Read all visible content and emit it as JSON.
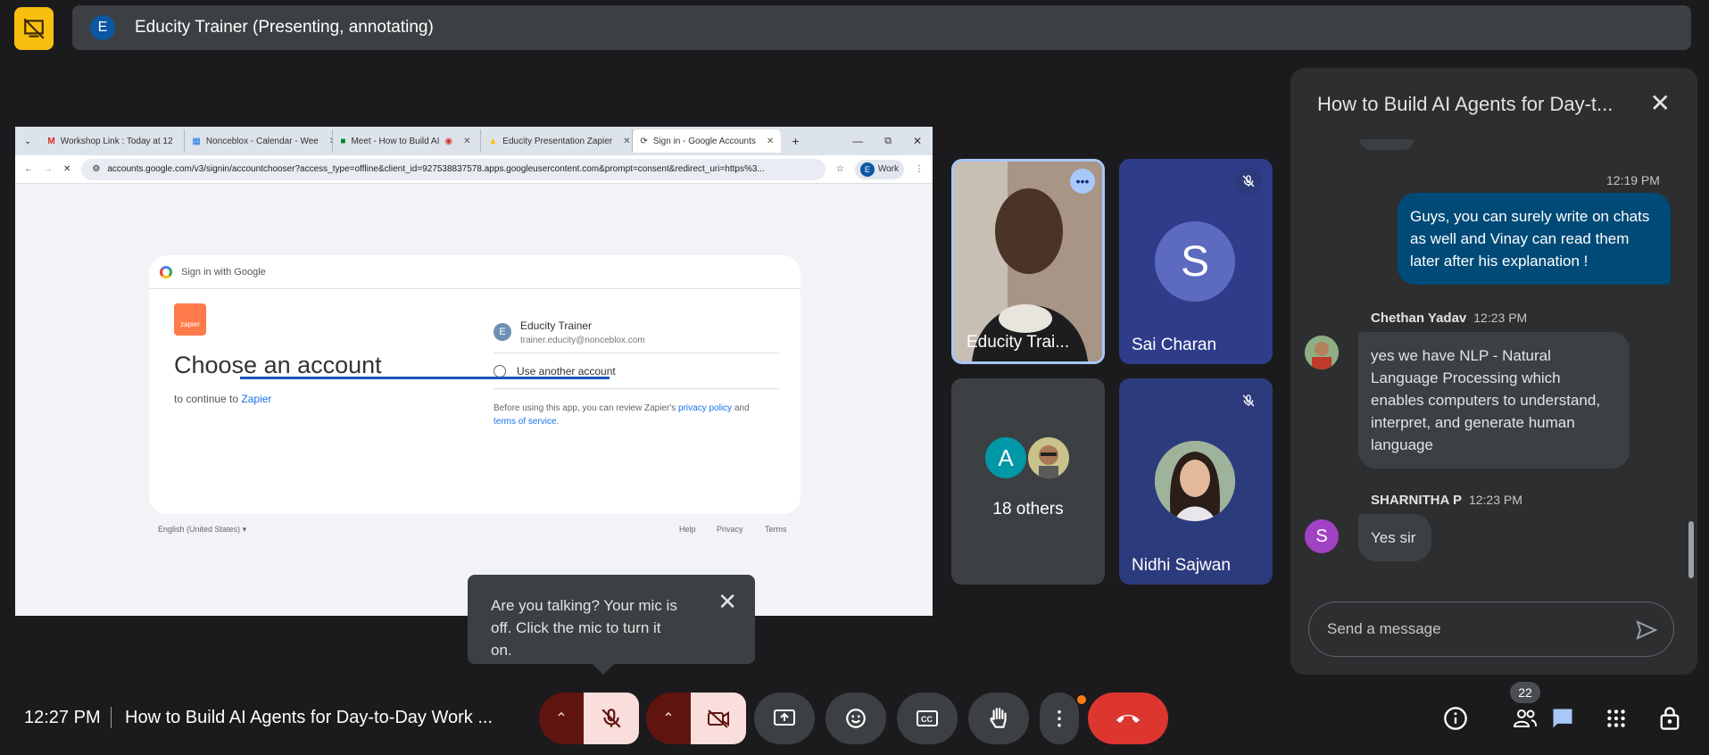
{
  "presenter": {
    "avatar_letter": "E",
    "label": "Educity Trainer (Presenting, annotating)"
  },
  "browser": {
    "tabs": [
      {
        "label": "Workshop Link : Today at 12",
        "icon": "gmail-icon"
      },
      {
        "label": "Nonceblox - Calendar - Wee",
        "icon": "calendar-icon"
      },
      {
        "label": "Meet - How to Build AI",
        "icon": "meet-icon"
      },
      {
        "label": "Educity Presentation Zapier",
        "icon": "drive-icon"
      },
      {
        "label": "Sign in - Google Accounts",
        "icon": "google-icon"
      }
    ],
    "url": "accounts.google.com/v3/signin/accountchooser?access_type=offline&client_id=927538837578.apps.googleusercontent.com&prompt=consent&redirect_uri=https%3...",
    "profile": {
      "letter": "E",
      "label": "Work"
    }
  },
  "signin": {
    "header": "Sign in with Google",
    "app_logo": "zapier",
    "heading": "Choose an account",
    "continue_prefix": "to continue to ",
    "continue_app": "Zapier",
    "account": {
      "letter": "E",
      "name": "Educity Trainer",
      "email": "trainer.educity@nonceblox.com"
    },
    "another": "Use another account",
    "fine_print_1": "Before using this app, you can review Zapier's ",
    "privacy": "privacy policy",
    "and": " and",
    "terms": "terms of service",
    "period": ".",
    "language": "English (United States)",
    "footer": [
      "Help",
      "Privacy",
      "Terms"
    ]
  },
  "participants": {
    "educity": "Educity Trai...",
    "sai": {
      "name": "Sai Charan",
      "letter": "S",
      "color": "#5c6bc0"
    },
    "others": {
      "label": "18 others",
      "letter": "A"
    },
    "nidhi": "Nidhi Sajwan"
  },
  "chat": {
    "title": "How to Build AI Agents for Day-t...",
    "messages": [
      {
        "time": "12:19 PM",
        "text": "Guys, you can surely write on chats as well and Vinay can read them later after his explanation !"
      },
      {
        "sender": "Chethan Yadav",
        "time": "12:23 PM",
        "text": "yes we have NLP - Natural Language Processing which enables computers to understand, interpret, and generate human language"
      },
      {
        "sender": "SHARNITHA P",
        "time": "12:23 PM",
        "letter": "S",
        "text": "Yes sir"
      }
    ],
    "input_placeholder": "Send a message"
  },
  "tooltip": {
    "text": "Are you talking? Your mic is off. Click the mic to turn it on."
  },
  "bottom": {
    "clock": "12:27 PM",
    "meeting_title": "How to Build AI Agents for Day-to-Day Work ...",
    "people_count": "22"
  }
}
